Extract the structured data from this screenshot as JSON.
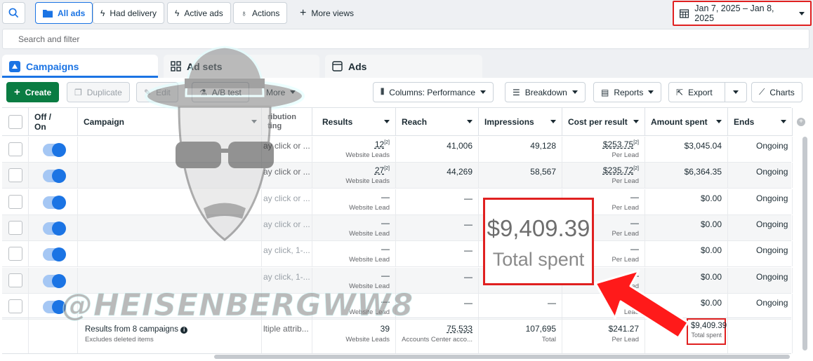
{
  "toolbar_top": {
    "all_ads": "All ads",
    "had_delivery": "Had delivery",
    "active_ads": "Active ads",
    "actions": "Actions",
    "more_views": "More views",
    "date_range": "Jan 7, 2025 – Jan 8, 2025"
  },
  "search": {
    "placeholder": "Search and filter"
  },
  "tabs": {
    "campaigns": "Campaigns",
    "ad_sets": "Ad sets",
    "ads": "Ads"
  },
  "actions": {
    "create": "Create",
    "duplicate": "Duplicate",
    "edit": "Edit",
    "ab_test": "A/B test",
    "more": "More",
    "columns": "Columns: Performance",
    "breakdown": "Breakdown",
    "reports": "Reports",
    "export": "Export",
    "charts": "Charts"
  },
  "columns": {
    "off_on": "Off / On",
    "campaign": "Campaign",
    "attribution": "ribution ting",
    "results": "Results",
    "reach": "Reach",
    "impressions": "Impressions",
    "cost_per_result": "Cost per result",
    "amount_spent": "Amount spent",
    "ends": "Ends"
  },
  "rows": [
    {
      "attr": "ay click or ...",
      "results": "12",
      "results_sup": "[2]",
      "results_sub": "Website Leads",
      "reach": "41,006",
      "impressions": "49,128",
      "cpr": "$253.75",
      "cpr_sup": "[2]",
      "cpr_sub": "Per Lead",
      "spent": "$3,045.04",
      "ends": "Ongoing"
    },
    {
      "attr": "ay click or ...",
      "results": "27",
      "results_sup": "[2]",
      "results_sub": "Website Leads",
      "reach": "44,269",
      "impressions": "58,567",
      "cpr": "$235.72",
      "cpr_sup": "[2]",
      "cpr_sub": "Per Lead",
      "spent": "$6,364.35",
      "ends": "Ongoing"
    },
    {
      "attr": "ay click or ...",
      "results": "—",
      "results_sup": "",
      "results_sub": "Website Lead",
      "reach": "—",
      "impressions": "—",
      "cpr": "—",
      "cpr_sup": "",
      "cpr_sub": "Per Lead",
      "spent": "$0.00",
      "ends": "Ongoing"
    },
    {
      "attr": "ay click or ...",
      "results": "—",
      "results_sup": "",
      "results_sub": "Website Lead",
      "reach": "—",
      "impressions": "—",
      "cpr": "—",
      "cpr_sup": "",
      "cpr_sub": "Per Lead",
      "spent": "$0.00",
      "ends": "Ongoing"
    },
    {
      "attr": "ay click, 1-...",
      "results": "—",
      "results_sup": "",
      "results_sub": "Website Lead",
      "reach": "—",
      "impressions": "—",
      "cpr": "—",
      "cpr_sup": "",
      "cpr_sub": "Per Lead",
      "spent": "$0.00",
      "ends": "Ongoing"
    },
    {
      "attr": "ay click, 1-...",
      "results": "—",
      "results_sup": "",
      "results_sub": "Website Lead",
      "reach": "—",
      "impressions": "—",
      "cpr": "—",
      "cpr_sup": "",
      "cpr_sub": "Per Lead",
      "spent": "$0.00",
      "ends": "Ongoing"
    },
    {
      "attr": "",
      "results": "—",
      "results_sup": "",
      "results_sub": "Website Lead",
      "reach": "—",
      "impressions": "—",
      "cpr": "—",
      "cpr_sup": "",
      "cpr_sub": "Lead",
      "spent": "$0.00",
      "ends": "Ongoing"
    }
  ],
  "summary": {
    "label": "Results from 8 campaigns",
    "sublabel": "Excludes deleted items",
    "attr": "ltiple attrib...",
    "results": "39",
    "results_sub": "Website Leads",
    "reach": "75,533",
    "reach_sub": "Accounts Center acco...",
    "impressions": "107,695",
    "impressions_sub": "Total",
    "cpr": "$241.27",
    "cpr_sub": "Per Lead",
    "spent": "$9,409.39",
    "spent_sub": "Total spent"
  },
  "callout": {
    "amount": "$9,409.39",
    "label": "Total spent"
  },
  "watermark": "@HEISENBERGWW8",
  "colors": {
    "accent": "#1b74e4",
    "create_green": "#0a7c42",
    "highlight_red": "#e02020"
  }
}
